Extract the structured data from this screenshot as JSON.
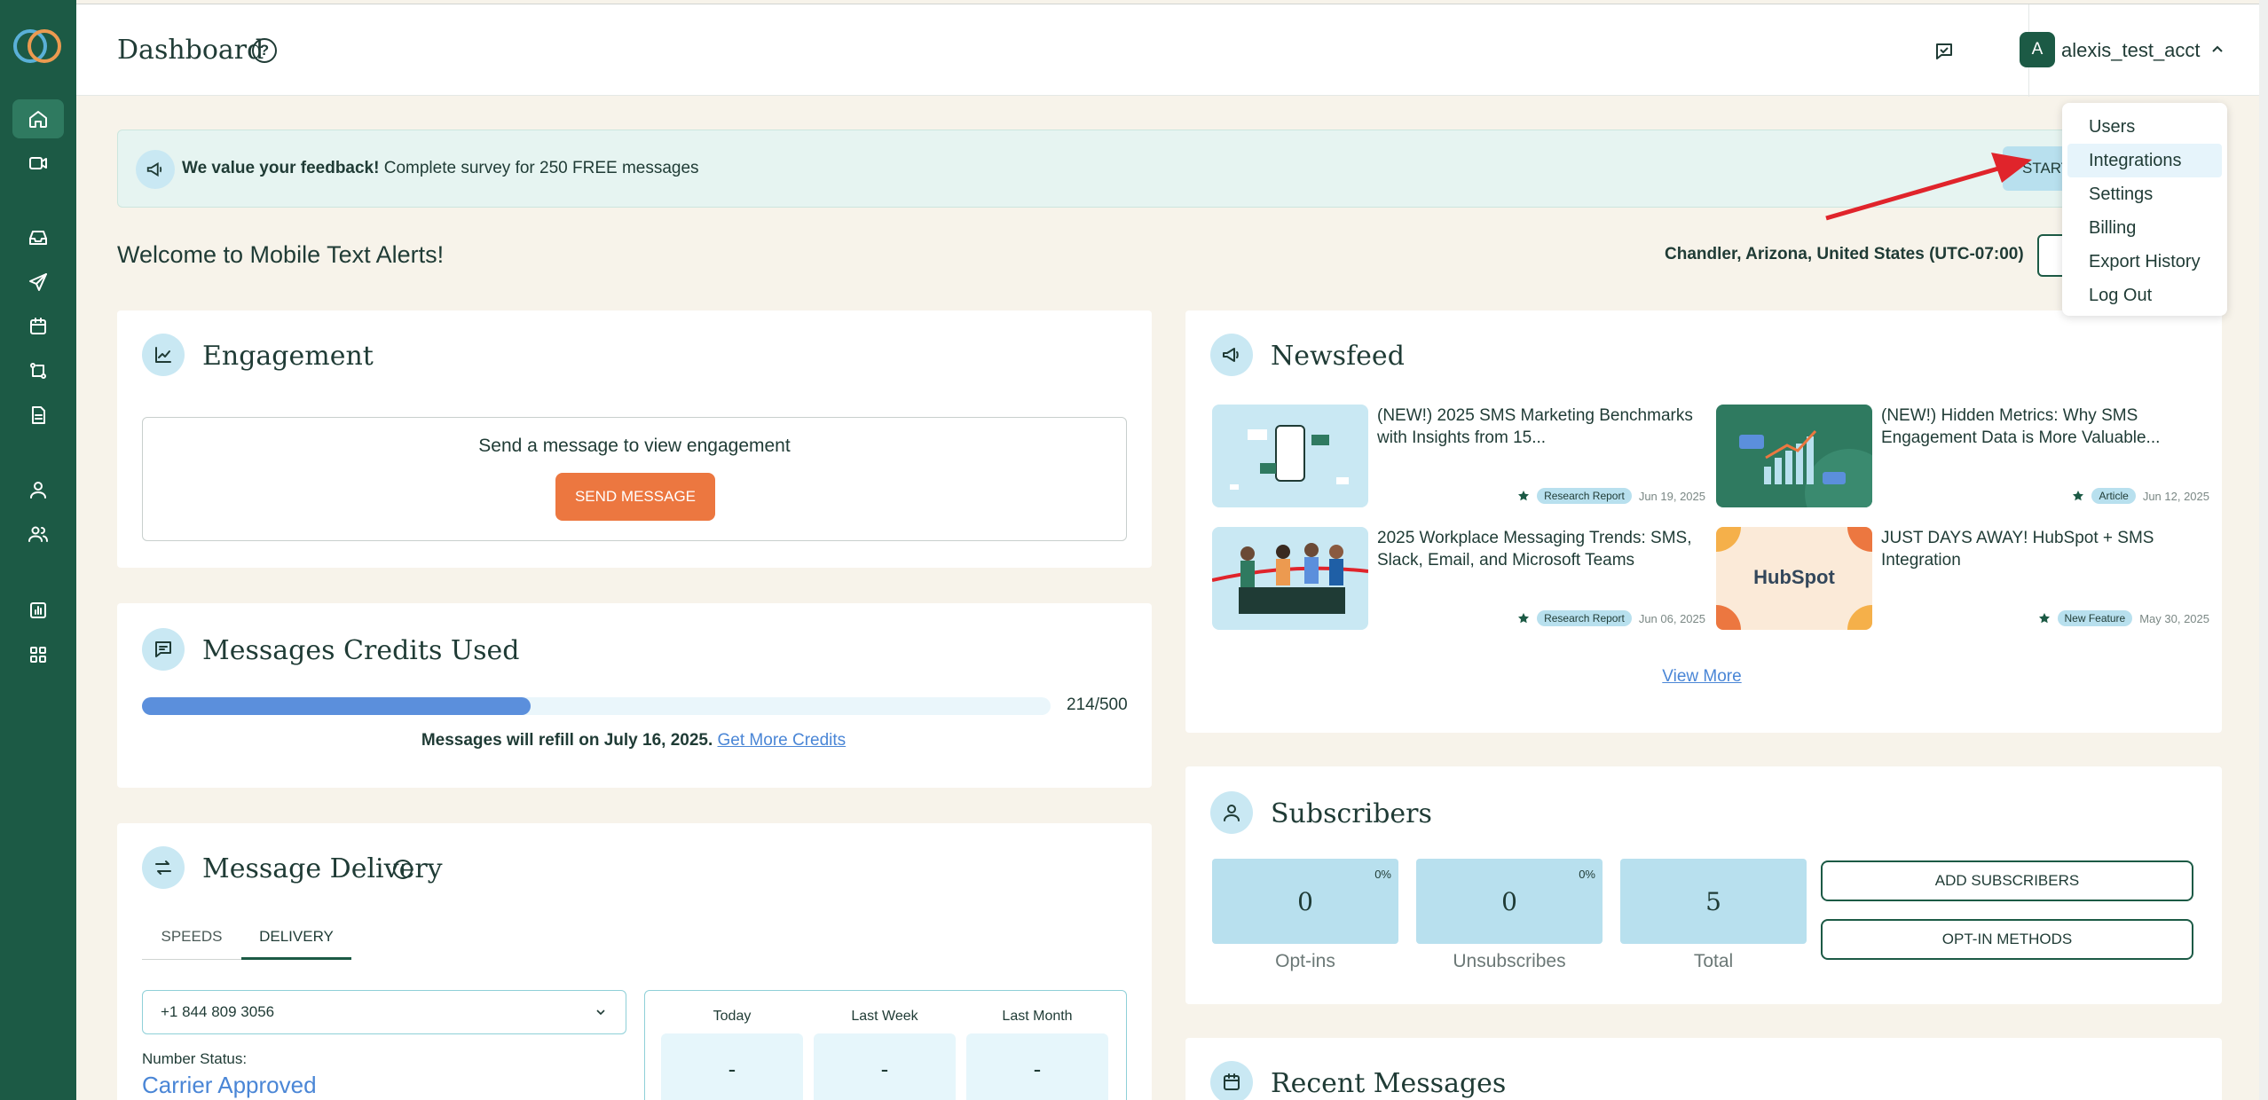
{
  "header": {
    "title": "Dashboard",
    "username": "alexis_test_acct",
    "avatar_initial": "A"
  },
  "user_menu": {
    "items": [
      "Users",
      "Integrations",
      "Settings",
      "Billing",
      "Export History",
      "Log Out"
    ],
    "highlighted": "Integrations"
  },
  "banner": {
    "bold": "We value your feedback!",
    "text": " Complete survey for 250 FREE messages",
    "button_label": "START"
  },
  "welcome": {
    "title": "Welcome to Mobile Text Alerts!",
    "timezone": "Chandler, Arizona, United States (UTC-07:00)"
  },
  "engagement": {
    "title": "Engagement",
    "message": "Send a message to view engagement",
    "button_label": "SEND MESSAGE"
  },
  "credits": {
    "title": "Messages Credits Used",
    "used": 214,
    "total": 500,
    "count_label": "214/500",
    "refill_text": "Messages will refill on July 16, 2025. ",
    "link_label": "Get More Credits"
  },
  "delivery": {
    "title": "Message Delivery",
    "tabs": [
      "SPEEDS",
      "DELIVERY"
    ],
    "active_tab": "DELIVERY",
    "number": "+1 844 809 3056",
    "status_label": "Number Status:",
    "status_value": "Carrier Approved",
    "stats": [
      {
        "label": "Today",
        "value": "-"
      },
      {
        "label": "Last Week",
        "value": "-"
      },
      {
        "label": "Last Month",
        "value": "-"
      }
    ]
  },
  "newsfeed": {
    "title": "Newsfeed",
    "items": [
      {
        "title": "(NEW!) 2025 SMS Marketing Benchmarks with Insights from 15...",
        "tag": "Research Report",
        "date": "Jun 19, 2025"
      },
      {
        "title": "(NEW!) Hidden Metrics: Why SMS Engagement Data is More Valuable...",
        "tag": "Article",
        "date": "Jun 12, 2025"
      },
      {
        "title": "2025 Workplace Messaging Trends: SMS, Slack, Email, and Microsoft Teams",
        "tag": "Research Report",
        "date": "Jun 06, 2025"
      },
      {
        "title": "JUST DAYS AWAY! HubSpot + SMS Integration",
        "tag": "New Feature",
        "date": "May 30, 2025"
      }
    ],
    "view_more": "View More",
    "hubspot_logo": "HubSpot"
  },
  "subscribers": {
    "title": "Subscribers",
    "tiles": [
      {
        "value": "0",
        "pct": "0%",
        "label": "Opt-ins"
      },
      {
        "value": "0",
        "pct": "0%",
        "label": "Unsubscribes"
      },
      {
        "value": "5",
        "pct": "",
        "label": "Total"
      }
    ],
    "add_button": "ADD SUBSCRIBERS",
    "optin_button": "OPT-IN METHODS"
  },
  "recent": {
    "title": "Recent Messages"
  },
  "colors": {
    "sidebar": "#1c5a45",
    "accent_orange": "#ec7740",
    "progress_blue": "#5b8fdc",
    "link_blue": "#4a86d6",
    "annotation_arrow": "#e0242b"
  }
}
